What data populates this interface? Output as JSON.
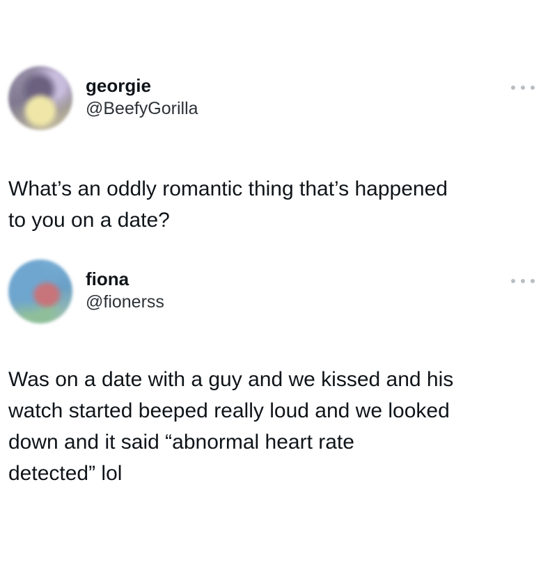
{
  "tweets": [
    {
      "display_name": "georgie",
      "handle": "@BeefyGorilla",
      "text_lines": [
        "What’s an oddly romantic thing that’s happened",
        "to you on a date?"
      ],
      "avatar_icon": "profile-photo-blurred",
      "menu_icon": "more-options-icon"
    },
    {
      "display_name": "fiona",
      "handle": "@fionerss",
      "text_lines": [
        "Was on a date with a guy and we kissed and his",
        "watch started beeped really loud and we looked",
        "down and it said “abnormal heart rate",
        "detected” lol"
      ],
      "avatar_icon": "profile-photo-blurred",
      "menu_icon": "more-options-icon"
    }
  ]
}
